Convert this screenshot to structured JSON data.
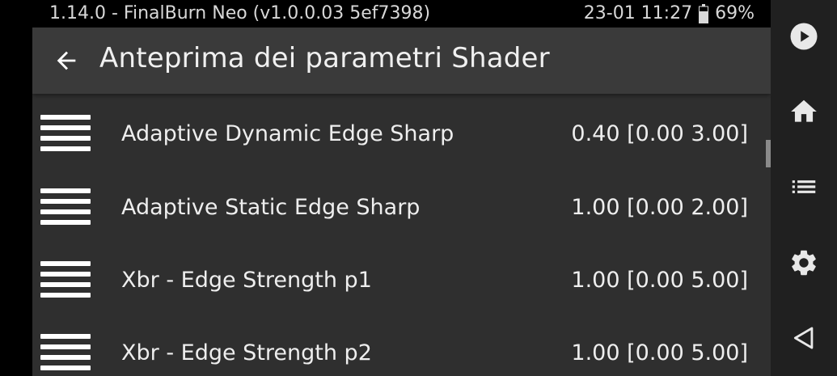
{
  "status_bar": {
    "app_info": "1.14.0 - FinalBurn Neo (v1.0.0.03  5ef7398)",
    "datetime": "23-01 11:27",
    "battery": "69%"
  },
  "toolbar": {
    "title": "Anteprima dei parametri Shader"
  },
  "parameters": [
    {
      "label": "Adaptive Dynamic Edge Sharp",
      "value": "0.40 [0.00 3.00]"
    },
    {
      "label": "Adaptive Static Edge Sharp",
      "value": "1.00 [0.00 2.00]"
    },
    {
      "label": "Xbr - Edge Strength p1",
      "value": "1.00 [0.00 5.00]"
    },
    {
      "label": "Xbr - Edge Strength p2",
      "value": "1.00 [0.00 5.00]"
    }
  ],
  "nav_bar": {
    "icons": [
      "play-icon",
      "home-icon",
      "list-icon",
      "settings-icon",
      "back-triangle-icon"
    ]
  },
  "colors": {
    "panel": "#2f2f2f",
    "toolbar": "#3a3a3a",
    "nav": "#202020",
    "text": "#eeeeee"
  }
}
